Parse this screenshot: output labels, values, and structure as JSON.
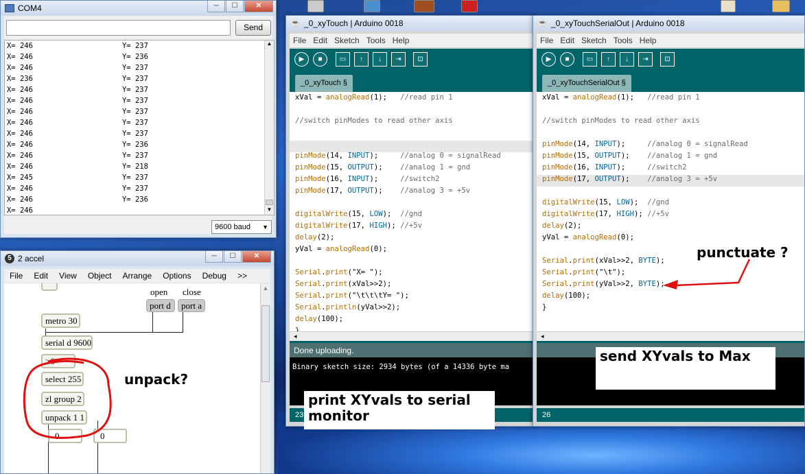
{
  "serial_monitor": {
    "title": "COM4",
    "send_label": "Send",
    "input_value": "",
    "baud": "9600 baud",
    "lines": [
      {
        "x": "X= 246",
        "y": "Y= 237"
      },
      {
        "x": "X= 246",
        "y": "Y= 236"
      },
      {
        "x": "X= 246",
        "y": "Y= 237"
      },
      {
        "x": "X= 236",
        "y": "Y= 237"
      },
      {
        "x": "X= 246",
        "y": "Y= 237"
      },
      {
        "x": "X= 246",
        "y": "Y= 237"
      },
      {
        "x": "X= 246",
        "y": "Y= 237"
      },
      {
        "x": "X= 246",
        "y": "Y= 237"
      },
      {
        "x": "X= 246",
        "y": "Y= 237"
      },
      {
        "x": "X= 246",
        "y": "Y= 236"
      },
      {
        "x": "X= 246",
        "y": "Y= 237"
      },
      {
        "x": "X= 246",
        "y": "Y= 218"
      },
      {
        "x": "X= 245",
        "y": "Y= 237"
      },
      {
        "x": "X= 246",
        "y": "Y= 237"
      },
      {
        "x": "X= 246",
        "y": "Y= 236"
      },
      {
        "x": "X= 246",
        "y": ""
      }
    ]
  },
  "max_patcher": {
    "title": "2 accel",
    "app_badge": "5",
    "menu": [
      "File",
      "Edit",
      "View",
      "Object",
      "Arrange",
      "Options",
      "Debug",
      ">>"
    ],
    "objects": {
      "metro": "metro 30",
      "serial": "serial d 9600",
      "gt": ">0",
      "select": "select 255",
      "zl": "zl group 2",
      "unpack": "unpack 1 1",
      "num_left": "0",
      "num_right": "0"
    },
    "messages": {
      "port_d": "port d",
      "port_a": "port a"
    },
    "labels": {
      "open": "open",
      "close": "close"
    },
    "annotation": "unpack?"
  },
  "arduino_left": {
    "title": "_0_xyTouch | Arduino 0018",
    "menu": [
      "File",
      "Edit",
      "Sketch",
      "Tools",
      "Help"
    ],
    "tab": "_0_xyTouch §",
    "status": "Done uploading.",
    "console": "Binary sketch size: 2934 bytes (of a 14336 byte ma",
    "line_number": "23",
    "code": [
      "xVal = analogRead(1);   //read pin 1",
      "",
      "//switch pinModes to read other axis",
      "",
      "",
      "pinMode(14, INPUT);     //analog 0 = signalRead",
      "pinMode(15, OUTPUT);    //analog 1 = gnd",
      "pinMode(16, INPUT);     //switch2",
      "pinMode(17, OUTPUT);    //analog 3 = +5v",
      "",
      "digitalWrite(15, LOW);  //gnd",
      "digitalWrite(17, HIGH); //+5v",
      "delay(2);",
      "yVal = analogRead(0);",
      "",
      "Serial.print(\"X= \");",
      "Serial.print(xVal>>2);",
      "Serial.print(\"\\t\\t\\tY= \");",
      "Serial.println(yVal>>2);",
      "delay(100);",
      "}"
    ],
    "annotation": "print XYvals to serial monitor"
  },
  "arduino_right": {
    "title": "_0_xyTouchSerialOut | Arduino 0018",
    "menu": [
      "File",
      "Edit",
      "Sketch",
      "Tools",
      "Help"
    ],
    "tab": "_0_xyTouchSerialOut §",
    "status": "",
    "console": "",
    "line_number": "26",
    "code": [
      "xVal = analogRead(1);   //read pin 1",
      "",
      "//switch pinModes to read other axis",
      "",
      "",
      "pinMode(14, INPUT);     //analog 0 = signalRead",
      "pinMode(15, OUTPUT);    //analog 1 = gnd",
      "pinMode(16, INPUT);     //switch2",
      "pinMode(17, OUTPUT);    //analog 3 = +5v",
      "",
      "digitalWrite(15, LOW);  //gnd",
      "digitalWrite(17, HIGH); //+5v",
      "delay(2);",
      "yVal = analogRead(0);",
      "",
      "Serial.print(xVal>>2, BYTE);",
      "Serial.print(\"\\t\");",
      "Serial.print(yVal>>2, BYTE);",
      "delay(100);",
      "}"
    ],
    "annotation_box": "send XYvals to Max",
    "annotation_arrow": "punctuate ?"
  },
  "colors": {
    "arduino_teal": "#006468",
    "annotation_red": "#e01010"
  }
}
